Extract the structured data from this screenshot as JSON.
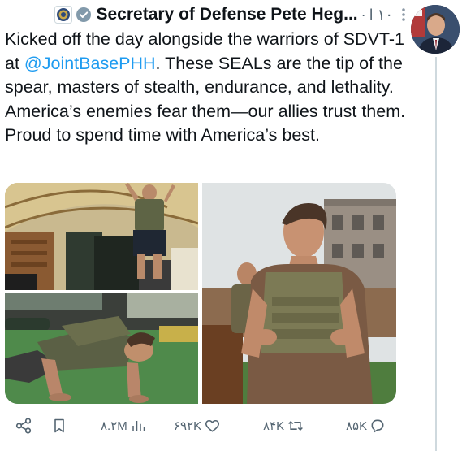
{
  "post": {
    "display_name": "Secretary of Defense Pete Heg...",
    "time": "۱۰ ا",
    "text_before_mention": "Kicked off the day alongside the warriors of SDVT-1 at ",
    "mention": "@JointBasePHH",
    "text_after_mention": ". These SEALs are the tip of the spear, masters of stealth, endurance, and lethality. America’s enemies fear them—our allies trust them. Proud to spend time with America’s best."
  },
  "media": {
    "count": 3,
    "images": [
      {
        "scene": "gym-box-jump"
      },
      {
        "scene": "push-up"
      },
      {
        "scene": "portrait-plate-carrier"
      }
    ]
  },
  "actions": {
    "replies": "۸۵K",
    "reposts": "۸۴K",
    "likes": "۶۹۲K",
    "views": "۸.۲M"
  },
  "icons": {
    "more": "more-vertical-icon",
    "verified": "verified-badge-icon",
    "affiliate": "dod-seal-icon",
    "reply": "reply-icon",
    "repost": "repost-icon",
    "like": "heart-icon",
    "views": "views-chart-icon",
    "bookmark": "bookmark-icon",
    "share": "share-icon"
  },
  "colors": {
    "text": "#0f1419",
    "secondary": "#536471",
    "link": "#1d9bf0",
    "verified_gray": "#829aab"
  }
}
